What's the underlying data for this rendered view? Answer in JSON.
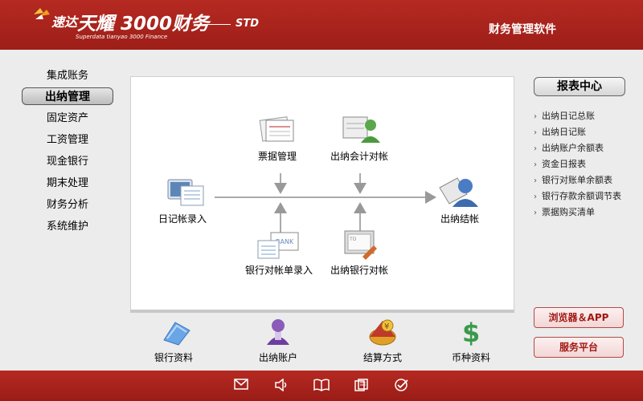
{
  "header": {
    "brand_name": "速达",
    "product_title": "天耀 3000财务",
    "product_subtitle": "Superdata tianyao 3000 Finance",
    "edition": "STD",
    "app_category": "财务管理软件"
  },
  "left_nav": {
    "items": [
      {
        "label": "集成账务"
      },
      {
        "label": "出纳管理"
      },
      {
        "label": "固定资产"
      },
      {
        "label": "工资管理"
      },
      {
        "label": "现金银行"
      },
      {
        "label": "期末处理"
      },
      {
        "label": "财务分析"
      },
      {
        "label": "系统维护"
      }
    ],
    "active_index": 1
  },
  "flow": {
    "journal_entry": "日记帐录入",
    "bill_management": "票据管理",
    "cashier_accounting_reconcile": "出纳会计对帐",
    "bank_statement_entry": "银行对帐单录入",
    "cashier_bank_reconcile": "出纳银行对帐",
    "cashier_closing": "出纳结帐"
  },
  "bottom_items": [
    {
      "label": "银行资料",
      "icon": "folder-icon"
    },
    {
      "label": "出纳账户",
      "icon": "user-account-icon"
    },
    {
      "label": "结算方式",
      "icon": "settlement-coins-icon"
    },
    {
      "label": "币种资料",
      "icon": "currency-icon"
    }
  ],
  "right_panel": {
    "report_center": "报表中心",
    "reports": [
      "出纳日记总账",
      "出纳日记账",
      "出纳账户余额表",
      "资金日报表",
      "银行对账单余额表",
      "银行存款余额调节表",
      "票据购买清单"
    ],
    "browser_app": "浏览器＆APP",
    "service_platform": "服务平台"
  },
  "footer": {
    "icons": [
      "mail-icon",
      "speaker-icon",
      "book-icon",
      "document-icon",
      "check-icon"
    ]
  },
  "colors": {
    "header_red": "#b52a22",
    "footer_red": "#9a1c16",
    "accent_red_text": "#a01812"
  }
}
